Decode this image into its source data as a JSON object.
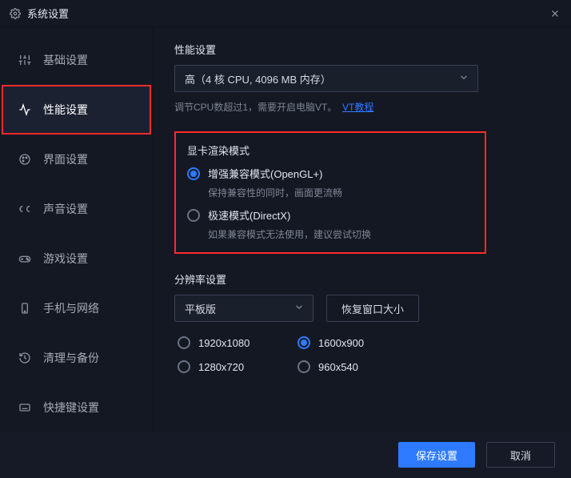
{
  "window": {
    "title": "系统设置"
  },
  "sidebar": {
    "items": [
      {
        "label": "基础设置",
        "icon": "sliders"
      },
      {
        "label": "性能设置",
        "icon": "activity"
      },
      {
        "label": "界面设置",
        "icon": "palette"
      },
      {
        "label": "声音设置",
        "icon": "sound"
      },
      {
        "label": "游戏设置",
        "icon": "gamepad"
      },
      {
        "label": "手机与网络",
        "icon": "phone"
      },
      {
        "label": "清理与备份",
        "icon": "history"
      },
      {
        "label": "快捷键设置",
        "icon": "keyboard"
      }
    ],
    "active_index": 1
  },
  "perf": {
    "section_title": "性能设置",
    "level_selected": "高（4 核 CPU, 4096 MB 内存）",
    "hint_prefix": "调节CPU数超过1，需要开启电脑VT。",
    "hint_link": "VT教程"
  },
  "render": {
    "section_title": "显卡渲染模式",
    "options": [
      {
        "label": "增强兼容模式(OpenGL+)",
        "hint": "保持兼容性的同时，画面更流畅"
      },
      {
        "label": "极速模式(DirectX)",
        "hint": "如果兼容模式无法使用，建议尝试切换"
      }
    ],
    "selected_index": 0
  },
  "resolution": {
    "section_title": "分辨率设置",
    "mode_selected": "平板版",
    "restore_btn": "恢复窗口大小",
    "options": [
      "1920x1080",
      "1600x900",
      "1280x720",
      "960x540"
    ],
    "selected_index": 1
  },
  "footer": {
    "save": "保存设置",
    "cancel": "取消"
  }
}
